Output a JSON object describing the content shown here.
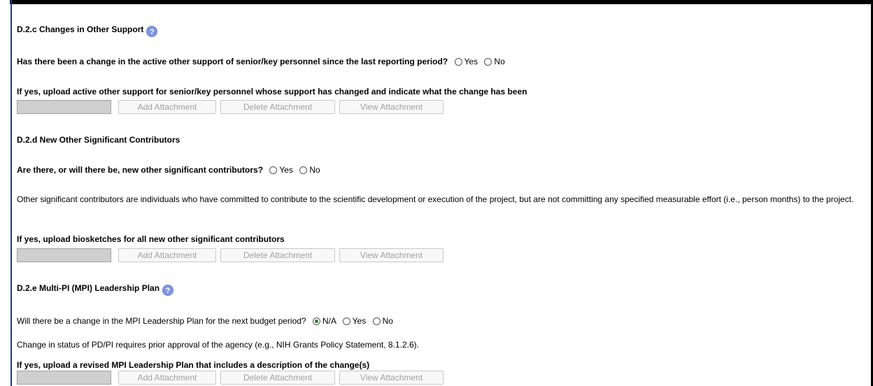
{
  "sections": {
    "d2c": {
      "title": "D.2.c Changes in Other Support",
      "question": "Has there been a change in the active other support of senior/key personnel since the last reporting period?",
      "yes": "Yes",
      "no": "No",
      "upload_label": "If yes, upload active other support for senior/key personnel whose support has changed and indicate what the change has been"
    },
    "d2d": {
      "title": "D.2.d New Other Significant Contributors",
      "question": "Are there, or will there be, new other significant contributors?",
      "yes": "Yes",
      "no": "No",
      "description": "Other significant contributors are individuals who have committed to contribute to the scientific development or execution of the project, but are not committing any specified measurable effort (i.e., person months) to the project.",
      "upload_label": "If yes, upload biosketches for all new other significant contributors"
    },
    "d2e": {
      "title": "D.2.e Multi-PI (MPI) Leadership Plan",
      "question": "Will there be a change in the MPI Leadership Plan for the next budget period?",
      "na": "N/A",
      "yes": "Yes",
      "no": "No",
      "selected": "N/A",
      "note": "Change in status of PD/PI requires prior approval of the agency (e.g., NIH Grants Policy Statement, 8.1.2.6).",
      "upload_label": "If yes, upload a revised MPI Leadership Plan that includes a description of the change(s)"
    }
  },
  "buttons": {
    "add": "Add Attachment",
    "delete": "Delete Attachment",
    "view": "View Attachment"
  },
  "icons": {
    "help": "?"
  },
  "colors": {
    "help_icon": "#8096e0",
    "frame_accent": "#1b3f91",
    "selected_radio": "#2a7a2a"
  }
}
